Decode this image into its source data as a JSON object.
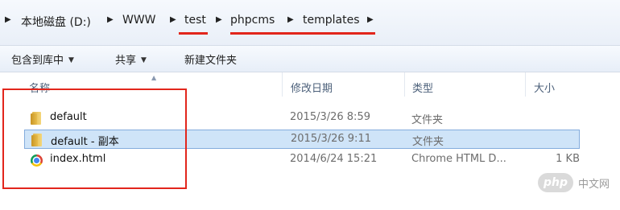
{
  "address_bar": {
    "crumbs": [
      "本地磁盘 (D:)",
      "WWW",
      "test",
      "phpcms",
      "templates"
    ],
    "separator": "▶"
  },
  "toolbar": {
    "include_label": "包含到库中",
    "share_label": "共享",
    "new_folder_label": "新建文件夹",
    "dropdown_arrow": "▼"
  },
  "columns": {
    "name": "名称",
    "modified": "修改日期",
    "type": "类型",
    "size": "大小"
  },
  "files": [
    {
      "name": "default",
      "modified": "2015/3/26 8:59",
      "type": "文件夹",
      "size": "",
      "icon": "folder-icon"
    },
    {
      "name": "default - 副本",
      "modified": "2015/3/26 9:11",
      "type": "文件夹",
      "size": "",
      "icon": "folder-icon",
      "selected": true
    },
    {
      "name": "index.html",
      "modified": "2014/6/24 15:21",
      "type": "Chrome HTML D...",
      "size": "1 KB",
      "icon": "chrome-icon"
    }
  ],
  "watermark": {
    "badge": "php",
    "text": "中文网"
  },
  "colors": {
    "annotation_red": "#e2261c",
    "selection": "#cfe4f8"
  }
}
